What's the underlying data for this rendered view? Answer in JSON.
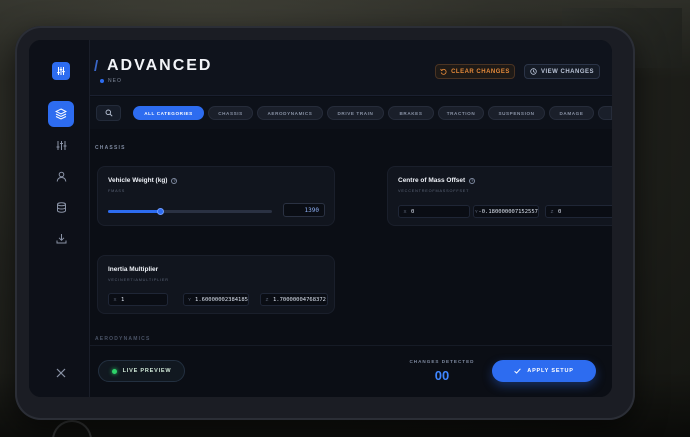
{
  "header": {
    "title": "ADVANCED",
    "subtitle": "NEO",
    "clear_label": "CLEAR CHANGES",
    "view_label": "VIEW CHANGES"
  },
  "sidebar": {
    "items": [
      {
        "icon": "layers-icon",
        "active": true
      },
      {
        "icon": "sliders-icon",
        "active": false
      },
      {
        "icon": "user-icon",
        "active": false
      },
      {
        "icon": "database-icon",
        "active": false
      },
      {
        "icon": "download-icon",
        "active": false
      }
    ],
    "close_icon": "close-icon"
  },
  "categories": [
    {
      "label": "ALL CATEGORIES",
      "active": true
    },
    {
      "label": "CHASSIS"
    },
    {
      "label": "AERODYNAMICS"
    },
    {
      "label": "DRIVE TRAIN"
    },
    {
      "label": "BRAKES"
    },
    {
      "label": "TRACTION"
    },
    {
      "label": "SUSPENSION"
    },
    {
      "label": "DAMAGE"
    }
  ],
  "sections": {
    "chassis": "CHASSIS",
    "aero": "AERODYNAMICS"
  },
  "cards": {
    "weight": {
      "title": "Vehicle Weight (kg)",
      "sub": "FMASS",
      "value": "1390",
      "slider_fraction": 0.32
    },
    "com": {
      "title": "Centre of Mass Offset",
      "sub": "VECCENTREOFMASSOFFSET",
      "x": "0",
      "y": "-0.180000007152557",
      "z": "0"
    },
    "inertia": {
      "title": "Inertia Multiplier",
      "sub": "VECINERTIAMULTIPLIER",
      "x": "1",
      "y": "1.60000002384185",
      "z": "1.70000004768372"
    }
  },
  "axes": {
    "x": "X",
    "y": "Y",
    "z": "Z"
  },
  "footer": {
    "live_label": "LIVE PREVIEW",
    "changes_label": "CHANGES DETECTED",
    "changes_count": "00",
    "apply_label": "APPLY SETUP"
  },
  "colors": {
    "accent": "#2d6cf0",
    "warning": "#e68a3a",
    "live": "#2ed36a"
  }
}
